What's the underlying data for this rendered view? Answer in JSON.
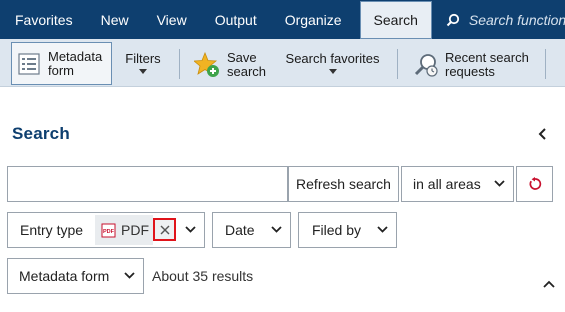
{
  "nav": {
    "tabs": [
      {
        "label": "Favorites"
      },
      {
        "label": "New"
      },
      {
        "label": "View"
      },
      {
        "label": "Output"
      },
      {
        "label": "Organize"
      },
      {
        "label": "Search"
      }
    ],
    "active_tab": "Search",
    "search_placeholder": "Search function"
  },
  "ribbon": {
    "metadata_form": {
      "line1": "Metadata",
      "line2": "form"
    },
    "filters": "Filters",
    "save_search": {
      "line1": "Save",
      "line2": "search"
    },
    "search_favorites": "Search favorites",
    "recent_requests": {
      "line1": "Recent search",
      "line2": "requests"
    }
  },
  "panel": {
    "title": "Search",
    "search_value": "",
    "refresh_label": "Refresh search",
    "area_selected": "in all areas",
    "entry_type_label": "Entry type",
    "entry_type_value": "PDF",
    "pdf_icon_text": "PDF",
    "date_label": "Date",
    "filed_by_label": "Filed by",
    "metadata_form_label": "Metadata form",
    "results_text": "About 35 results"
  },
  "colors": {
    "nav_bg": "#0e3f6f",
    "ribbon_bg": "#dde6ef",
    "title_color": "#0e3f6f",
    "highlight_red": "#e0131a",
    "reset_red": "#c8102e"
  }
}
